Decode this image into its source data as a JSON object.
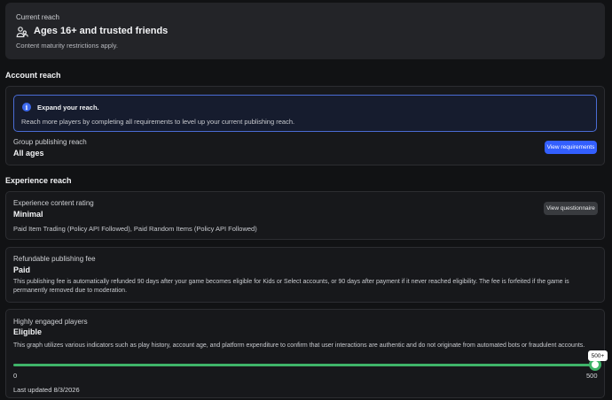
{
  "current_reach": {
    "label": "Current reach",
    "value": "Ages 16+ and trusted friends",
    "note": "Content maturity restrictions apply."
  },
  "account_reach": {
    "heading": "Account reach",
    "info": {
      "title": "Expand your reach.",
      "body": "Reach more players by completing all requirements to level up your current publishing reach."
    },
    "group_label": "Group publishing reach",
    "group_value": "All ages",
    "button": "View requirements"
  },
  "experience_reach": {
    "heading": "Experience reach",
    "rating": {
      "label": "Experience content rating",
      "value": "Minimal",
      "details": "Paid Item Trading (Policy API Followed), Paid Random Items (Policy API Followed)",
      "button": "View questionnaire"
    },
    "fee": {
      "label": "Refundable publishing fee",
      "value": "Paid",
      "body_line1": "This publishing fee is automatically refunded 90 days after your game becomes eligible for Kids or Select accounts, or 90 days after payment if it never reached eligibility. The fee is forfeited if the game is",
      "body_line2": "permanently removed due to moderation."
    },
    "engaged": {
      "label": "Highly engaged players",
      "value": "Eligible",
      "body": "This graph utilizes various indicators such as play history, account age, and platform expenditure to confirm that user interactions are authentic and do not originate from automated bots or fraudulent accounts.",
      "slider_min": "0",
      "slider_max": "500",
      "slider_tooltip": "500+",
      "slider_fill_fraction": 1.0,
      "last_updated": "Last updated 8/3/2026"
    }
  },
  "colors": {
    "accent_blue": "#335fff",
    "success_green": "#3fb469",
    "background": "#111214"
  },
  "icons": {
    "reach": "people-icon",
    "info": "info-icon"
  }
}
